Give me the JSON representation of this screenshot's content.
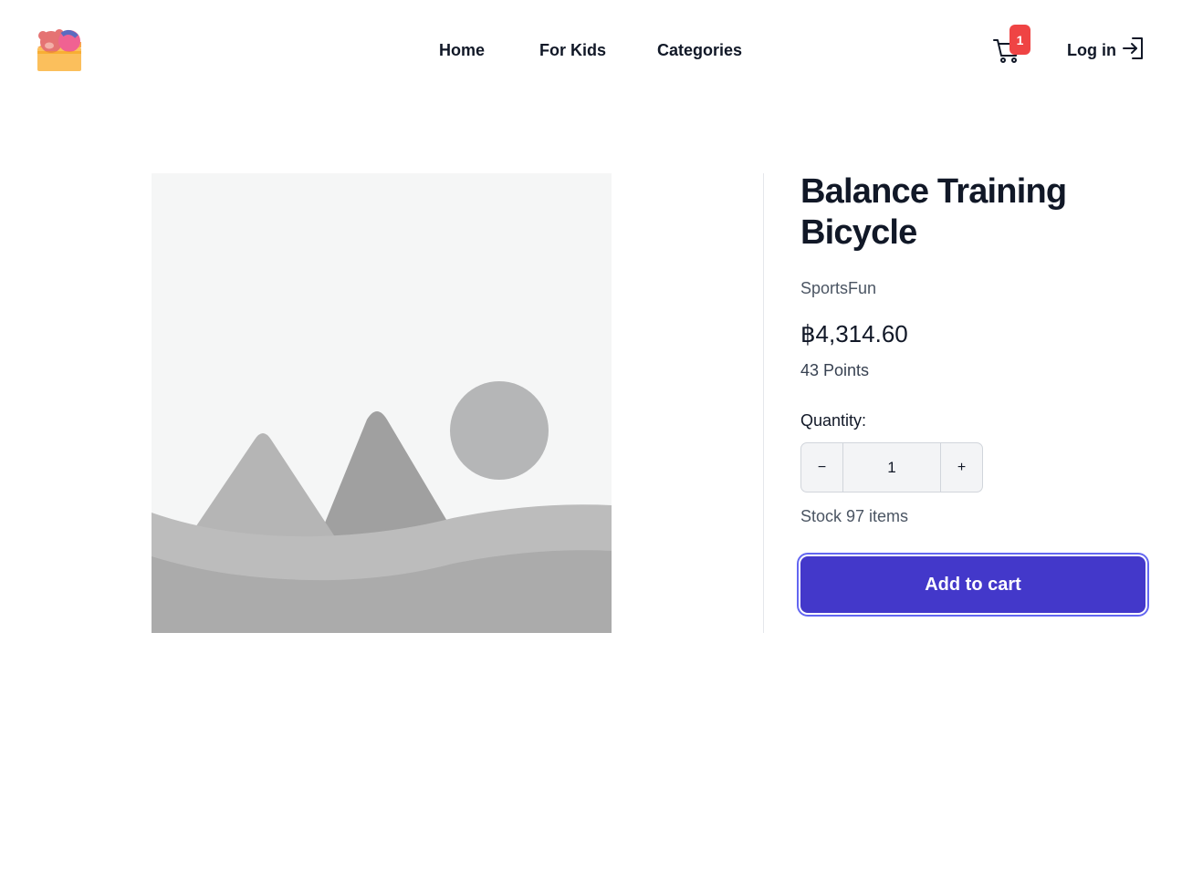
{
  "header": {
    "logo_icon": "bear-in-box-logo-icon",
    "nav": [
      {
        "label": "Home"
      },
      {
        "label": "For Kids"
      },
      {
        "label": "Categories"
      }
    ],
    "cart_icon": "shopping-cart-icon",
    "cart_count": "1",
    "login_label": "Log in",
    "login_icon": "log-in-icon"
  },
  "product": {
    "image_icon": "image-placeholder-icon",
    "title": "Balance Training Bicycle",
    "brand": "SportsFun",
    "price": "฿4,314.60",
    "points": "43 Points",
    "quantity_label": "Quantity:",
    "quantity_value": "1",
    "decrement_label": "−",
    "increment_label": "+",
    "stock_text": "Stock 97 items",
    "add_to_cart_label": "Add to cart"
  },
  "colors": {
    "accent": "#4338ca",
    "focus_ring": "#6366f1",
    "badge": "#ef4444",
    "text": "#111827",
    "muted_text": "#4b5563"
  }
}
